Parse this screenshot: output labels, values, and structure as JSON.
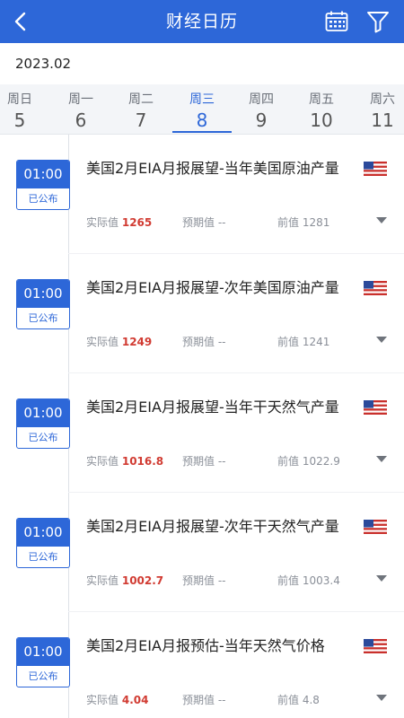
{
  "header": {
    "title": "财经日历",
    "back_icon": "back-arrow-icon",
    "calendar_icon": "calendar-icon",
    "filter_icon": "filter-icon"
  },
  "month_label": "2023.02",
  "week": [
    {
      "weekday": "周日",
      "day": "5",
      "active": false
    },
    {
      "weekday": "周一",
      "day": "6",
      "active": false
    },
    {
      "weekday": "周二",
      "day": "7",
      "active": false
    },
    {
      "weekday": "周三",
      "day": "8",
      "active": true
    },
    {
      "weekday": "周四",
      "day": "9",
      "active": false
    },
    {
      "weekday": "周五",
      "day": "10",
      "active": false
    },
    {
      "weekday": "周六",
      "day": "11",
      "active": false
    }
  ],
  "labels": {
    "actual": "实际值",
    "forecast": "预期值",
    "previous": "前值"
  },
  "events": [
    {
      "time": "01:00",
      "status": "已公布",
      "title": "美国2月EIA月报展望-当年美国原油产量",
      "actual": "1265",
      "forecast": "--",
      "previous": "1281",
      "flag": "us-flag-icon"
    },
    {
      "time": "01:00",
      "status": "已公布",
      "title": "美国2月EIA月报展望-次年美国原油产量",
      "actual": "1249",
      "forecast": "--",
      "previous": "1241",
      "flag": "us-flag-icon"
    },
    {
      "time": "01:00",
      "status": "已公布",
      "title": "美国2月EIA月报展望-当年干天然气产量",
      "actual": "1016.8",
      "forecast": "--",
      "previous": "1022.9",
      "flag": "us-flag-icon"
    },
    {
      "time": "01:00",
      "status": "已公布",
      "title": "美国2月EIA月报展望-次年干天然气产量",
      "actual": "1002.7",
      "forecast": "--",
      "previous": "1003.4",
      "flag": "us-flag-icon"
    },
    {
      "time": "01:00",
      "status": "已公布",
      "title": "美国2月EIA月报预估-当年天然气价格",
      "actual": "4.04",
      "forecast": "--",
      "previous": "4.8",
      "flag": "us-flag-icon"
    }
  ],
  "colors": {
    "brand": "#2d67d8",
    "actual_value": "#d13b32",
    "muted": "#8a8f98"
  }
}
